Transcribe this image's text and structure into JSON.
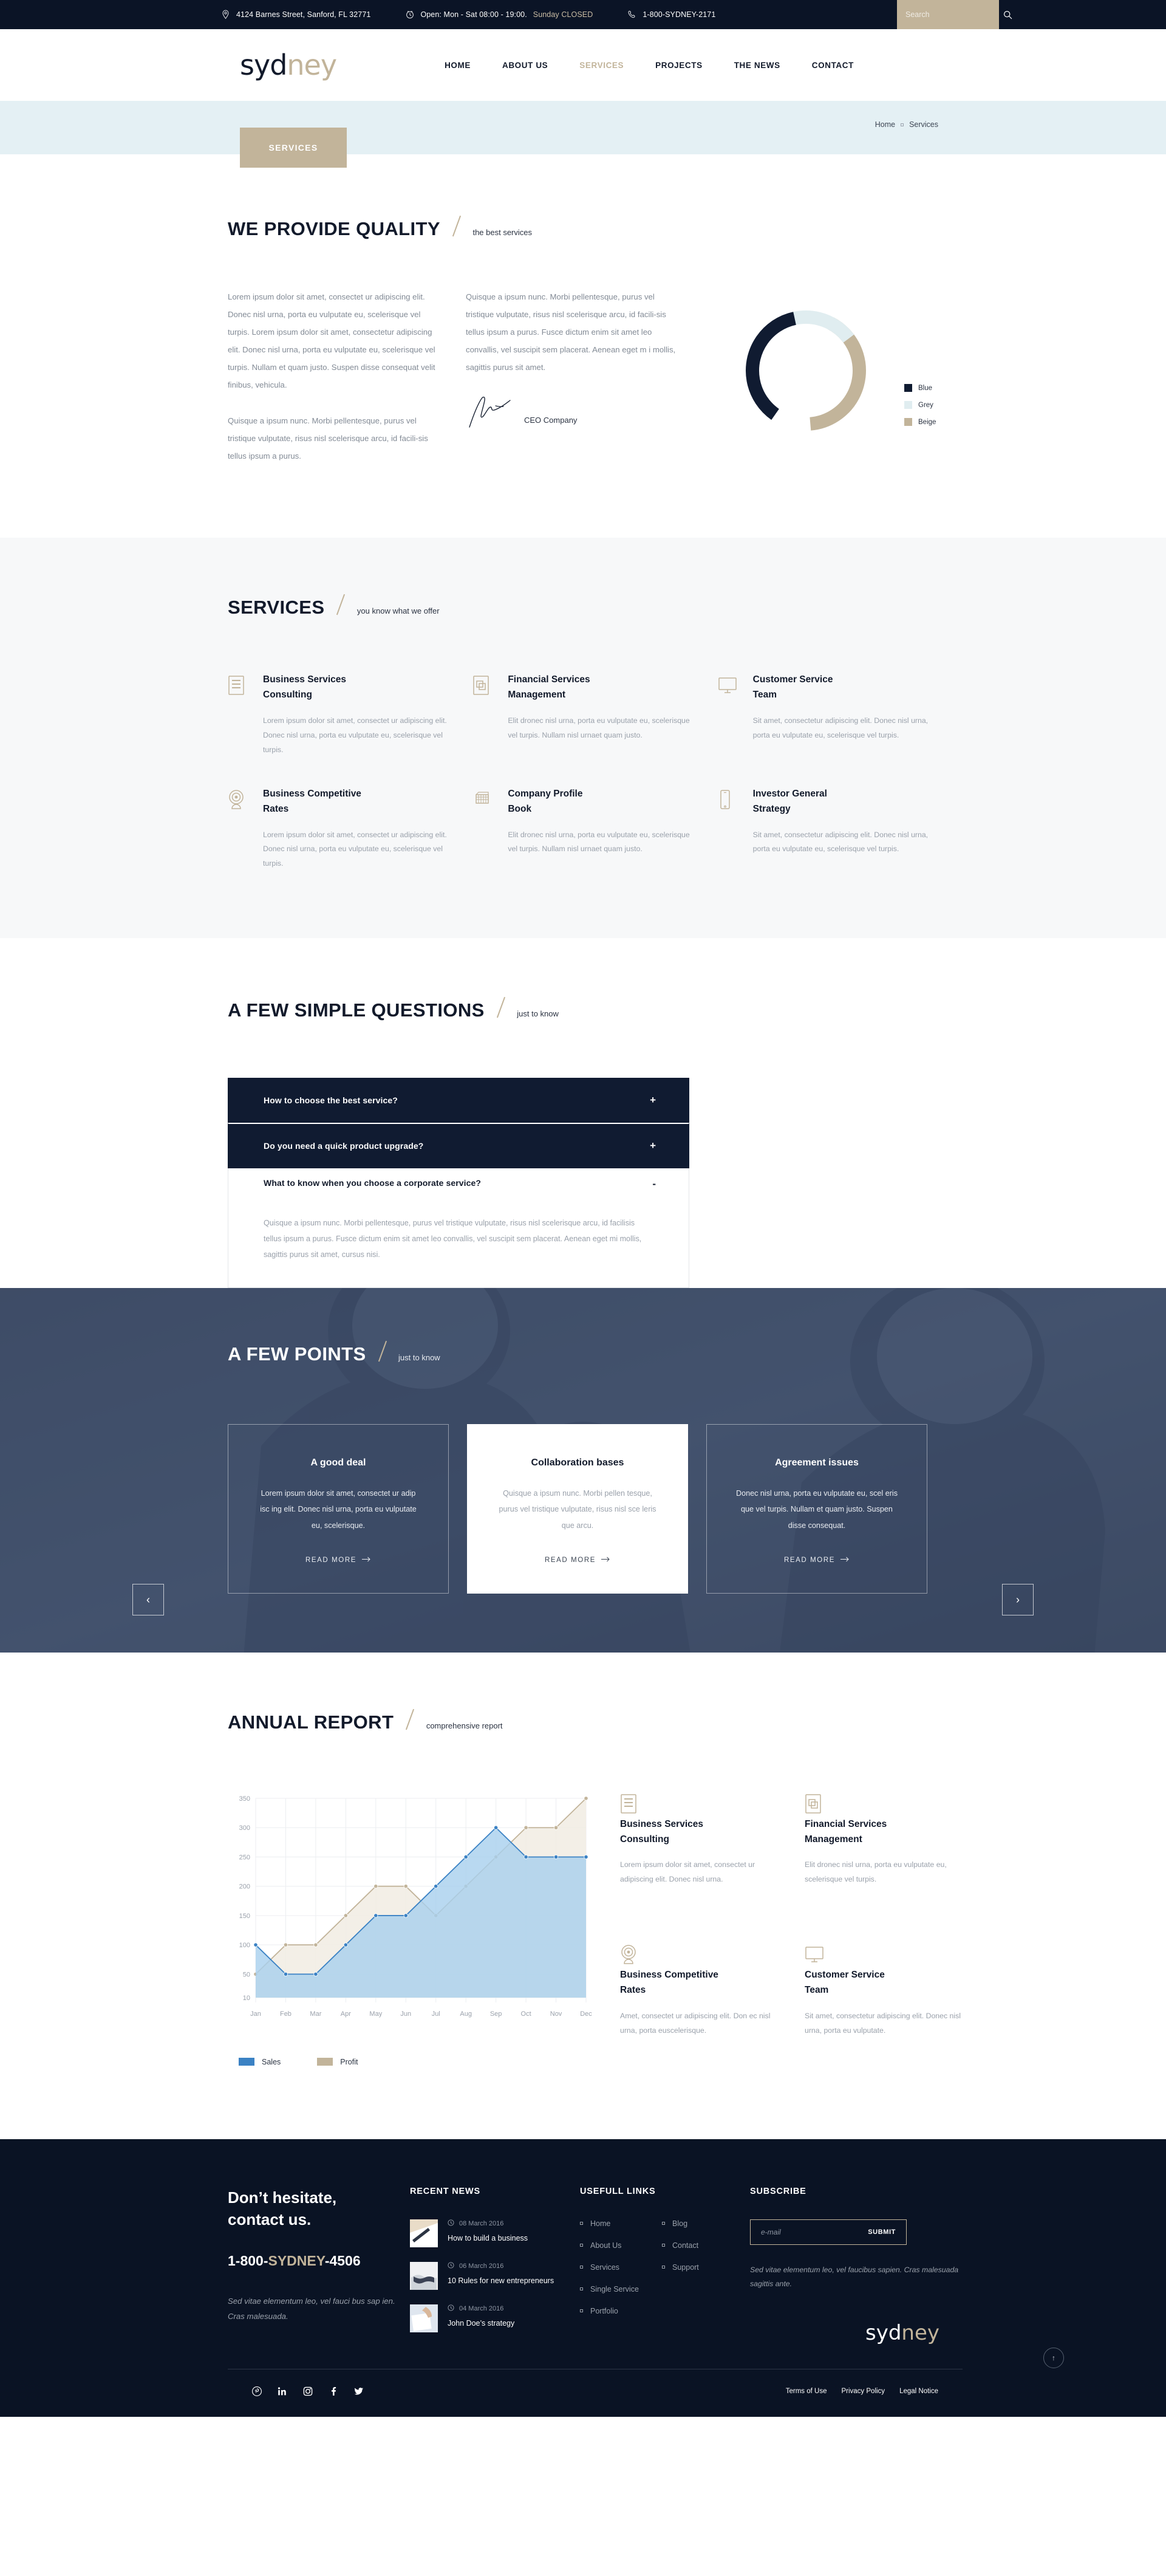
{
  "topbar": {
    "address": "4124 Barnes Street, Sanford, FL 32771",
    "hours_prefix": "Open: Mon - Sat 08:00 - 19:00.",
    "hours_sunday": "Sunday CLOSED",
    "phone": "1-800-SYDNEY-2171",
    "search_placeholder": "Search"
  },
  "brand": {
    "part1": "syd",
    "part2": "ney"
  },
  "nav": [
    {
      "label": "HOME",
      "active": false
    },
    {
      "label": "ABOUT US",
      "active": false
    },
    {
      "label": "SERVICES",
      "active": true
    },
    {
      "label": "PROJECTS",
      "active": false
    },
    {
      "label": "THE NEWS",
      "active": false
    },
    {
      "label": "CONTACT",
      "active": false
    }
  ],
  "banner": {
    "tag": "SERVICES",
    "crumb_home": "Home",
    "crumb_current": "Services"
  },
  "quality": {
    "title": "WE PROVIDE QUALITY",
    "subtitle": "the best services",
    "p1": "Lorem ipsum dolor sit amet, consectet ur adipiscing elit. Donec nisl urna, porta eu vulputate eu, scelerisque vel turpis. Lorem ipsum dolor sit amet, consectetur adipiscing elit. Donec nisl urna, porta eu vulputate eu, scelerisque vel turpis. Nullam et quam justo. Suspen disse consequat velit finibus, vehicula.",
    "p2": "Quisque a ipsum nunc. Morbi pellentesque, purus vel tristique vulputate, risus nisl scelerisque arcu, id facili-sis tellus ipsum a purus.",
    "p3": "Quisque a ipsum nunc. Morbi pellentesque, purus vel tristique vulputate, risus nisl scelerisque arcu, id facili-sis tellus ipsum a purus. Fusce dictum enim sit amet leo convallis, vel suscipit sem placerat. Aenean eget m i mollis, sagittis purus sit amet.",
    "ceo_label": "CEO Company"
  },
  "donut": {
    "colors": {
      "blue": "#101b31",
      "grey": "#e0edf0",
      "beige": "#c2b49a"
    },
    "legend": [
      {
        "label": "Blue",
        "color": "#101b31",
        "value": 37
      },
      {
        "label": "Grey",
        "color": "#e0edf0",
        "value": 22
      },
      {
        "label": "Beige",
        "color": "#c2b49a",
        "value": 41
      }
    ]
  },
  "services": {
    "title": "SERVICES",
    "subtitle": "you know what we offer",
    "items": [
      {
        "icon": "document-icon",
        "title": "Business Services\nConsulting",
        "line1": "Business Services",
        "line2": "Consulting",
        "text": "Lorem ipsum dolor sit amet, consectet ur adipiscing elit. Donec nisl urna, porta eu vulputate eu, scelerisque vel turpis."
      },
      {
        "icon": "copy-icon",
        "line1": "Financial Services",
        "line2": "Management",
        "text": "Elit dronec nisl urna, porta eu vulputate eu, scelerisque vel turpis. Nullam nisl urnaet quam justo."
      },
      {
        "icon": "monitor-icon",
        "line1": "Customer Service",
        "line2": "Team",
        "text": "Sit amet, consectetur adipiscing elit. Donec nisl urna, porta eu vulputate eu, scelerisque vel turpis."
      },
      {
        "icon": "target-icon",
        "line1": "Business Competitive",
        "line2": "Rates",
        "text": "Lorem ipsum dolor sit amet, consectet ur adipiscing elit. Donec nisl urna, porta eu vulputate eu, scelerisque vel turpis."
      },
      {
        "icon": "keyboard-icon",
        "line1": "Company Profile",
        "line2": "Book",
        "text": "Elit dronec nisl urna, porta eu vulputate eu, scelerisque vel turpis. Nullam nisl urnaet quam justo."
      },
      {
        "icon": "mobile-icon",
        "line1": "Investor General",
        "line2": "Strategy",
        "text": "Sit amet, consectetur adipiscing elit. Donec nisl urna, porta eu vulputate eu, scelerisque vel turpis."
      }
    ]
  },
  "faq": {
    "title": "A FEW SIMPLE QUESTIONS",
    "subtitle": "just to know",
    "items": [
      {
        "question": "How to choose the best service?",
        "sign": "+",
        "open": false,
        "answer": ""
      },
      {
        "question": "Do you need a quick product upgrade?",
        "sign": "+",
        "open": false,
        "answer": ""
      },
      {
        "question": "What to know when you choose a corporate service?",
        "sign": "-",
        "open": true,
        "answer": "Quisque a ipsum nunc. Morbi pellentesque, purus vel tristique vulputate, risus nisl scelerisque arcu, id facilisis tellus ipsum a purus. Fusce dictum enim sit amet leo convallis, vel suscipit sem placerat. Aenean eget mi mollis, sagittis purus sit amet, cursus nisi."
      }
    ]
  },
  "points": {
    "title": "A FEW POINTS",
    "subtitle": "just to know",
    "prev": "‹",
    "next": "›",
    "cards": [
      {
        "title": "A good deal",
        "text": "Lorem ipsum dolor sit amet, consectet ur adip isc ing elit. Donec nisl urna, porta eu vulputate eu, scelerisque.",
        "cta": "READ MORE",
        "highlight": false
      },
      {
        "title": "Collaboration bases",
        "text": "Quisque a ipsum nunc. Morbi pellen tesque, purus vel tristique vulputate, risus nisl sce leris que arcu.",
        "cta": "READ MORE",
        "highlight": true
      },
      {
        "title": "Agreement issues",
        "text": "Donec nisl urna, porta eu vulputate eu, scel eris que vel turpis. Nullam et quam justo. Suspen disse consequat.",
        "cta": "READ MORE",
        "highlight": false
      }
    ]
  },
  "annual": {
    "title": "ANNUAL REPORT",
    "subtitle": "comprehensive report",
    "items": [
      {
        "icon": "document-icon",
        "line1": "Business Services",
        "line2": "Consulting",
        "text": "Lorem ipsum dolor sit amet, consectet ur adipiscing elit. Donec nisl urna."
      },
      {
        "icon": "copy-icon",
        "line1": "Financial Services",
        "line2": "Management",
        "text": "Elit dronec nisl urna, porta eu vulputate eu, scelerisque vel turpis."
      },
      {
        "icon": "target-icon",
        "line1": "Business Competitive",
        "line2": "Rates",
        "text": "Amet, consectet ur adipiscing elit. Don ec nisl urna, porta euscelerisque."
      },
      {
        "icon": "monitor-icon",
        "line1": "Customer Service",
        "line2": "Team",
        "text": "Sit amet, consectetur adipiscing elit. Donec nisl urna, porta eu vulputate."
      }
    ]
  },
  "chart_data": {
    "type": "area",
    "title": "ANNUAL REPORT",
    "xlabel": "",
    "ylabel": "",
    "categories": [
      "Jan",
      "Feb",
      "Mar",
      "Apr",
      "May",
      "Jun",
      "Jul",
      "Aug",
      "Sep",
      "Oct",
      "Nov",
      "Dec"
    ],
    "yticks": [
      10,
      50,
      100,
      150,
      200,
      250,
      300,
      350
    ],
    "ylim": [
      10,
      350
    ],
    "grid": true,
    "legend_position": "bottom-left",
    "series": [
      {
        "name": "Sales",
        "color": "#3b82c4",
        "fill": "#a8d0ee",
        "values": [
          100,
          50,
          50,
          100,
          150,
          150,
          200,
          250,
          300,
          250,
          250,
          250
        ]
      },
      {
        "name": "Profit",
        "color": "#c2b49a",
        "fill": "#f1ece3",
        "values": [
          50,
          100,
          100,
          150,
          200,
          200,
          150,
          200,
          250,
          300,
          300,
          350
        ]
      }
    ]
  },
  "footer": {
    "contact_heading_l1": "Don’t hesitate,",
    "contact_heading_l2": "contact us.",
    "phone_pre": "1-800-",
    "phone_hl": "SYDNEY",
    "phone_post": "-4506",
    "contact_note": "Sed vitae elementum leo, vel fauci bus sap ien. Cras malesuada.",
    "news_title": "RECENT NEWS",
    "news": [
      {
        "date": "08 March 2016",
        "title": "How to build a business"
      },
      {
        "date": "06 March 2016",
        "title": "10 Rules for new entrepreneurs"
      },
      {
        "date": "04 March 2016",
        "title": "John Doe’s strategy"
      }
    ],
    "links_title": "USEFULL LINKS",
    "links_col1": [
      "Home",
      "About Us",
      "Services",
      "Single Service",
      "Portfolio"
    ],
    "links_col2": [
      "Blog",
      "Contact",
      "Support"
    ],
    "subscribe_title": "SUBSCRIBE",
    "email_placeholder": "e-mail",
    "submit_label": "SUBMIT",
    "subscribe_note": "Sed vitae elementum leo, vel faucibus sapien. Cras malesuada sagittis ante.",
    "legal": [
      "Terms of Use",
      "Privacy Policy",
      "Legal Notice"
    ],
    "socials": [
      "pinterest-icon",
      "linkedin-icon",
      "instagram-icon",
      "facebook-icon",
      "twitter-icon"
    ],
    "totop": "↑"
  }
}
